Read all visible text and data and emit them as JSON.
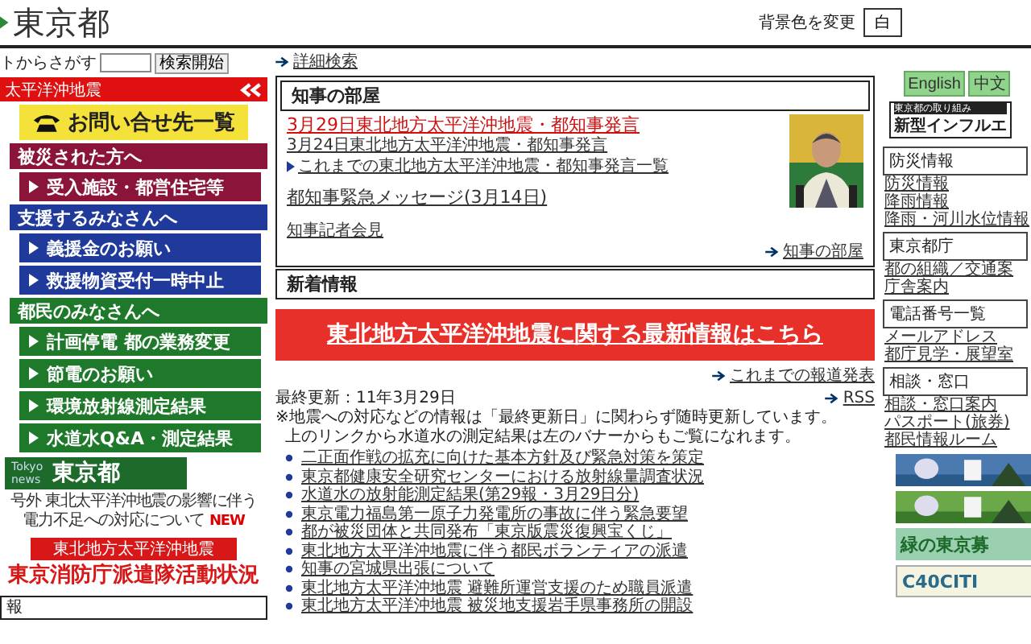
{
  "header": {
    "logo": "東京都",
    "bg_label": "背景色を変更",
    "bg_button": "白"
  },
  "left": {
    "search_label": "トからさがす",
    "search_button": "検索開始",
    "quake_bar": "太平洋沖地震",
    "contact": "お問い合せ先一覧",
    "sections": [
      {
        "title": "被災された方へ",
        "color": "#8a1538",
        "links": [
          "受入施設・都営住宅等"
        ]
      },
      {
        "title": "支援するみなさんへ",
        "color": "#1f3a9a",
        "links": [
          "義援金のお願い",
          "救援物資受付一時中止"
        ]
      },
      {
        "title": "都民のみなさんへ",
        "color": "#1e7a2a",
        "links": [
          "計画停電 都の業務変更",
          "節電のお願い",
          "環境放射線測定結果",
          "水道水Q&A・測定結果"
        ]
      }
    ],
    "news_banner": {
      "en_top": "Tokyo",
      "en_bottom": "news",
      "title": "東京都"
    },
    "notice": {
      "line1": "号外 東北太平洋沖地震の影響に伴う",
      "line2": "電力不足への対応について",
      "badge": "NEW"
    },
    "fire_banner": {
      "top": "東北地方太平洋沖地震",
      "main": "東京消防庁派遣隊活動状況"
    },
    "bottom_box": "報"
  },
  "center": {
    "detail_search": "詳細検索",
    "governor": {
      "title": "知事の部屋",
      "links": [
        {
          "text": "3月29日東北地方太平洋沖地震・都知事発言",
          "kind": "highlight"
        },
        {
          "text": "3月24日東北地方太平洋沖地震・都知事発言",
          "kind": "plain"
        },
        {
          "text": "これまでの東北地方太平洋沖地震・都知事発言一覧",
          "kind": "pointer"
        }
      ],
      "message": "都知事緊急メッセージ(3月14日)",
      "press": "知事記者会見",
      "more": "知事の部屋"
    },
    "news_title": "新着情報",
    "banner": "東北地方太平洋沖地震に関する最新情報はこちら",
    "press_link": "これまでの報道発表",
    "rss": "RSS",
    "updated": "最終更新：11年3月29日",
    "notes": [
      "※地震への対応などの情報は「最終更新日」に関わらず随時更新しています。",
      "上のリンクから水道水の測定結果は左のバナーからもご覧になれます。"
    ],
    "items": [
      "二正面作戦の拡充に向けた基本方針及び緊急対策を策定",
      "東京都健康安全研究センターにおける放射線量調査状況",
      "水道水の放射能測定結果(第29報・3月29日分)",
      "東京電力福島第一原子力発電所の事故に伴う緊急要望",
      "都が被災団体と共同発布「東京版震災復興宝くじ」",
      "東北地方太平洋沖地震に伴う都民ボランティアの派遣",
      "知事の宮城県出張について",
      "東北地方太平洋沖地震 避難所運営支援のため職員派遣",
      "東北地方太平洋沖地震 被災地支援岩手県事務所の開設"
    ]
  },
  "right": {
    "langs": [
      "English",
      "中文"
    ],
    "flu_top": "東京都の取り組み",
    "flu": "新型インフルエ",
    "groups": [
      {
        "title": "防災情報",
        "links": [
          "防災情報",
          "降雨情報",
          "降雨・河川水位情報"
        ]
      },
      {
        "title": "東京都庁",
        "links": [
          "都の組織／交通案",
          "庁舎案内"
        ]
      },
      {
        "title": "電話番号一覧",
        "links": [
          "メールアドレス",
          "都庁見学・展望室"
        ]
      },
      {
        "title": "相談・窓口",
        "links": [
          "相談・窓口案内",
          "パスポート(旅券)",
          "都民情報ルーム"
        ]
      }
    ],
    "banners": [
      {
        "kind": "picture"
      },
      {
        "kind": "picture"
      },
      {
        "kind": "text",
        "text": "緑の東京募"
      },
      {
        "kind": "text",
        "text": "C40CITI"
      }
    ]
  }
}
